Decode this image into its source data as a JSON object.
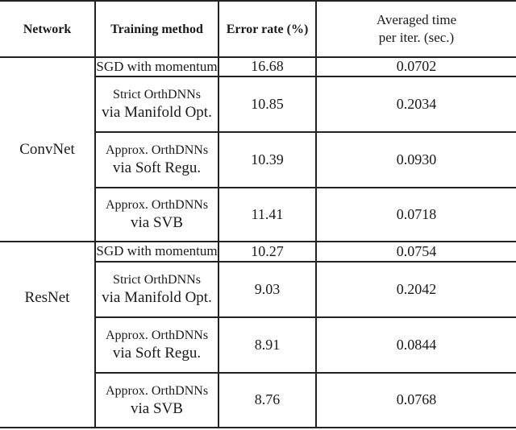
{
  "table": {
    "headers": {
      "network": "Network",
      "method": "Training method",
      "error": "Error rate (%)",
      "time_line1": "Averaged time",
      "time_line2": "per iter. (sec.)"
    },
    "groups": [
      {
        "network": "ConvNet",
        "rows": [
          {
            "method_l1": "SGD with momentum",
            "method_l2": "",
            "error": "16.68",
            "time": "0.0702"
          },
          {
            "method_l1": "Strict OrthDNNs",
            "method_l2": "via Manifold Opt.",
            "error": "10.85",
            "time": "0.2034"
          },
          {
            "method_l1": "Approx. OrthDNNs",
            "method_l2": "via Soft Regu.",
            "error": "10.39",
            "time": "0.0930"
          },
          {
            "method_l1": "Approx. OrthDNNs",
            "method_l2": "via SVB",
            "error": "11.41",
            "time": "0.0718"
          }
        ]
      },
      {
        "network": "ResNet",
        "rows": [
          {
            "method_l1": "SGD with momentum",
            "method_l2": "",
            "error": "10.27",
            "time": "0.0754"
          },
          {
            "method_l1": "Strict OrthDNNs",
            "method_l2": "via Manifold Opt.",
            "error": "9.03",
            "time": "0.2042"
          },
          {
            "method_l1": "Approx. OrthDNNs",
            "method_l2": "via Soft Regu.",
            "error": "8.91",
            "time": "0.0844"
          },
          {
            "method_l1": "Approx. OrthDNNs",
            "method_l2": "via SVB",
            "error": "8.76",
            "time": "0.0768"
          }
        ]
      }
    ]
  }
}
